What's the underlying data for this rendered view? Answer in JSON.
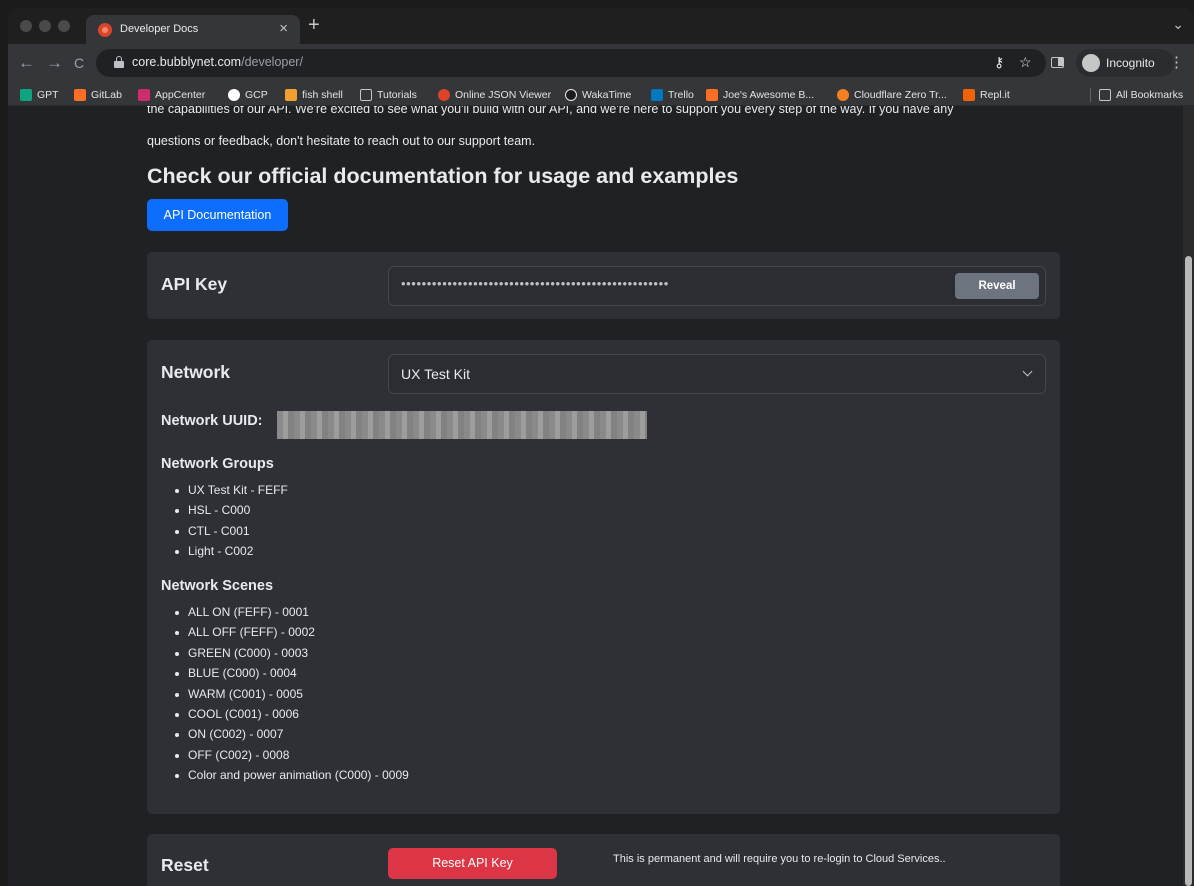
{
  "browser": {
    "tab_title": "Developer Docs",
    "tab_close": "×",
    "new_tab": "+",
    "tab_menu": "⌄",
    "url_host": "core.bubblynet.com",
    "url_path": "/developer/",
    "incognito_label": "Incognito",
    "back": "←",
    "forward": "→",
    "reload": "C",
    "key_icon": "⚷",
    "star_icon": "☆",
    "menu_icon": "⋮"
  },
  "bookmarks": [
    {
      "label": "GPT",
      "color": "#10a37f"
    },
    {
      "label": "GitLab",
      "color": "#fc6d26"
    },
    {
      "label": "AppCenter",
      "color": "#cb2e6d"
    },
    {
      "label": "GCP",
      "color": "#ffffff"
    },
    {
      "label": "fish shell",
      "color": "#f0a030"
    },
    {
      "label": "Tutorials",
      "color": "#c4c7c5"
    },
    {
      "label": "Online JSON Viewer",
      "color": "#d9442b"
    },
    {
      "label": "WakaTime",
      "color": "#1b1b1b"
    },
    {
      "label": "Trello",
      "color": "#0079bf"
    },
    {
      "label": "Joe's Awesome B...",
      "color": "#fc6d26"
    },
    {
      "label": "Cloudflare Zero Tr...",
      "color": "#f38020"
    },
    {
      "label": "Repl.it",
      "color": "#f26207"
    },
    {
      "label": "All Bookmarks",
      "color": "#c4c7c5"
    }
  ],
  "page": {
    "intro_line1": "the capabilities of our API. We're excited to see what you'll build with our API, and we're here to support you every step of the way. If you have any",
    "intro_line2": "questions or feedback, don't hesitate to reach out to our support team.",
    "docs_heading": "Check our official documentation for usage and examples",
    "docs_button": "API Documentation",
    "api_key_title": "API Key",
    "api_key_masked": "••••••••••••••••••••••••••••••••••••••••••••••••••••",
    "reveal_button": "Reveal",
    "network_title": "Network",
    "network_selected": "UX Test Kit",
    "uuid_label": "Network UUID:",
    "groups_title": "Network Groups",
    "groups": [
      "UX Test Kit - FEFF",
      "HSL - C000",
      "CTL - C001",
      "Light - C002"
    ],
    "scenes_title": "Network Scenes",
    "scenes": [
      "ALL ON (FEFF) - 0001",
      "ALL OFF (FEFF) - 0002",
      "GREEN (C000) - 0003",
      "BLUE (C000) - 0004",
      "WARM (C001) - 0005",
      "COOL (C001) - 0006",
      "ON (C002) - 0007",
      "OFF (C002) - 0008",
      "Color and power animation (C000) - 0009"
    ],
    "reset_title": "Reset",
    "reset_button": "Reset API Key",
    "reset_note": "This is permanent and will require you to re-login to Cloud Services.."
  },
  "colors": {
    "primary_button": "#0d6efd",
    "danger_button": "#dc3545",
    "secondary_button": "#6c7480",
    "card_bg": "#2e3036"
  }
}
